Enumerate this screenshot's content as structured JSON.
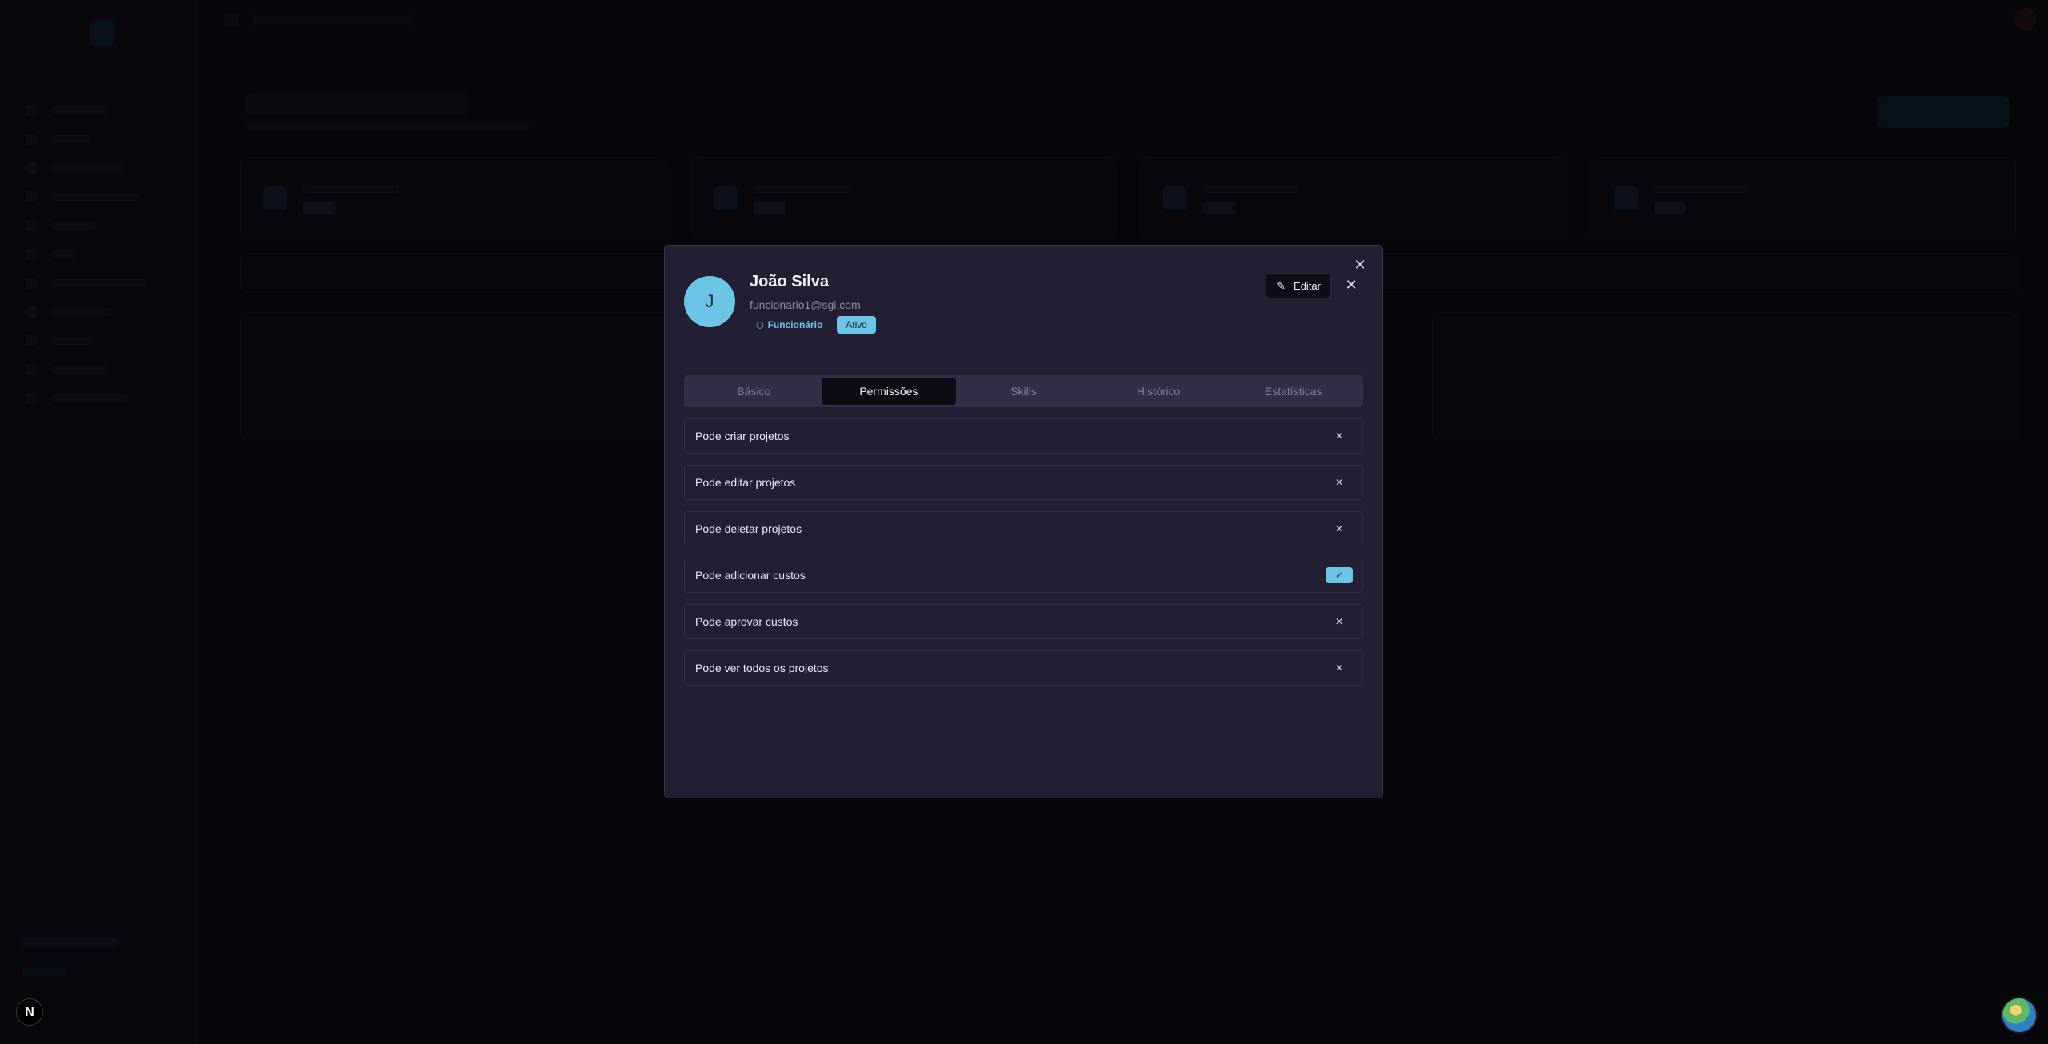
{
  "user": {
    "avatar_initial": "J",
    "name": "João Silva",
    "email": "funcionario1@sgi.com",
    "role": "Funcionário",
    "status": "Ativo"
  },
  "actions": {
    "edit_label": "Editar"
  },
  "icons": {
    "close": "close-icon",
    "edit": "edit-icon",
    "role": "shield-icon",
    "check": "check-icon"
  },
  "tabs": [
    {
      "label": "Básico",
      "active": false
    },
    {
      "label": "Permissões",
      "active": true
    },
    {
      "label": "Skills",
      "active": false
    },
    {
      "label": "Histórico",
      "active": false
    },
    {
      "label": "Estatísticas",
      "active": false
    }
  ],
  "permissions": [
    {
      "label": "Pode criar projetos",
      "enabled": false
    },
    {
      "label": "Pode editar projetos",
      "enabled": false
    },
    {
      "label": "Pode deletar projetos",
      "enabled": false
    },
    {
      "label": "Pode adicionar custos",
      "enabled": true
    },
    {
      "label": "Pode aprovar custos",
      "enabled": false
    },
    {
      "label": "Pode ver todos os projetos",
      "enabled": false
    }
  ],
  "floating": {
    "next_badge": "N"
  },
  "colors": {
    "accent": "#6cc4e6",
    "modal_bg": "#231f33",
    "page_bg": "#0a0910"
  }
}
